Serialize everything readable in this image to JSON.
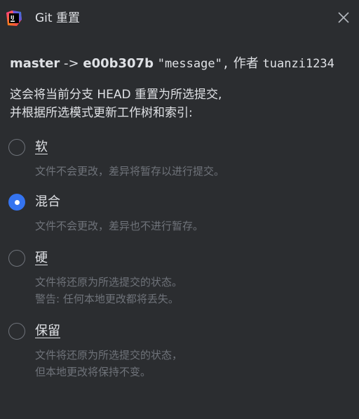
{
  "window": {
    "title": "Git 重置",
    "app_icon": "intellij-app-icon",
    "close_icon": "close-icon"
  },
  "commit": {
    "branch": "master",
    "arrow": "->",
    "hash": "e00b307b",
    "message": "\"message\",",
    "author_prefix": "作者",
    "author": "tuanzi1234"
  },
  "description": {
    "line1": "这会将当前分支 HEAD 重置为所选提交,",
    "line2": "并根据所选模式更新工作树和索引:"
  },
  "options": [
    {
      "label": "软",
      "checked": false,
      "desc_line1": "文件不会更改，差异将暂存以进行提交。",
      "desc_line2": ""
    },
    {
      "label": "混合",
      "checked": true,
      "desc_line1": "文件不会更改，差异也不进行暂存。",
      "desc_line2": ""
    },
    {
      "label": "硬",
      "checked": false,
      "desc_line1": "文件将还原为所选提交的状态。",
      "desc_line2": "警告: 任何本地更改都将丢失。"
    },
    {
      "label": "保留",
      "checked": false,
      "desc_line1": "文件将还原为所选提交的状态，",
      "desc_line2": "但本地更改将保持不变。"
    }
  ],
  "colors": {
    "background": "#2b2d30",
    "text": "#dfe1e5",
    "muted_text": "#6f737a",
    "accent": "#3574f0"
  }
}
